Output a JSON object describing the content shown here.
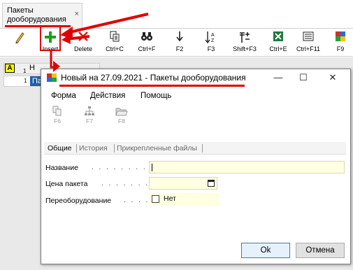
{
  "outer_tab": {
    "title": "Пакеты дооборудования",
    "close": "×"
  },
  "toolbar": {
    "buttons": [
      {
        "label": "",
        "icon": "pencil-icon"
      },
      {
        "label": "Insert",
        "icon": "plus-icon"
      },
      {
        "label": "Delete",
        "icon": "delete-x-icon"
      },
      {
        "label": "Ctrl+C",
        "icon": "copy-icon"
      },
      {
        "label": "Ctrl+F",
        "icon": "binoculars-icon"
      },
      {
        "label": "F2",
        "icon": "sort-az-icon"
      },
      {
        "label": "F3",
        "icon": "sort-az-icon"
      },
      {
        "label": "Shift+F3",
        "icon": "filter-plus-minus-icon"
      },
      {
        "label": "Ctrl+E",
        "icon": "excel-icon"
      },
      {
        "label": "Ctrl+F11",
        "icon": "list-icon"
      },
      {
        "label": "F9",
        "icon": "color-grid-icon"
      }
    ]
  },
  "grid": {
    "header_letter": "A",
    "col_header": "Н",
    "col_header2": "Н",
    "row_number": "1",
    "selected_cell": "Па",
    "head_number": "1"
  },
  "dialog": {
    "title": "Новый на 27.09.2021 - Пакеты дооборудования",
    "minimize": "—",
    "maximize": "☐",
    "close": "✕",
    "menu": [
      "Форма",
      "Действия",
      "Помощь"
    ],
    "tools": [
      {
        "label": "F6",
        "icon": "copy-doc-icon"
      },
      {
        "label": "F7",
        "icon": "tree-icon"
      },
      {
        "label": "F8",
        "icon": "folder-open-icon"
      }
    ],
    "tabs": [
      "Общие",
      "История",
      "Прикрепленные файлы"
    ],
    "fields": {
      "name_label": "Название",
      "name_value": "",
      "price_label": "Цена пакета",
      "price_value": "",
      "reequip_label": "Переоборудование",
      "reequip_value": "Нет",
      "dots": ". . . . . . . . . . ."
    },
    "ok": "Ok",
    "cancel": "Отмена"
  },
  "colors": {
    "accent_red": "#e00000",
    "selection_blue": "#1e5fa8",
    "input_bg": "#ffffe1"
  }
}
